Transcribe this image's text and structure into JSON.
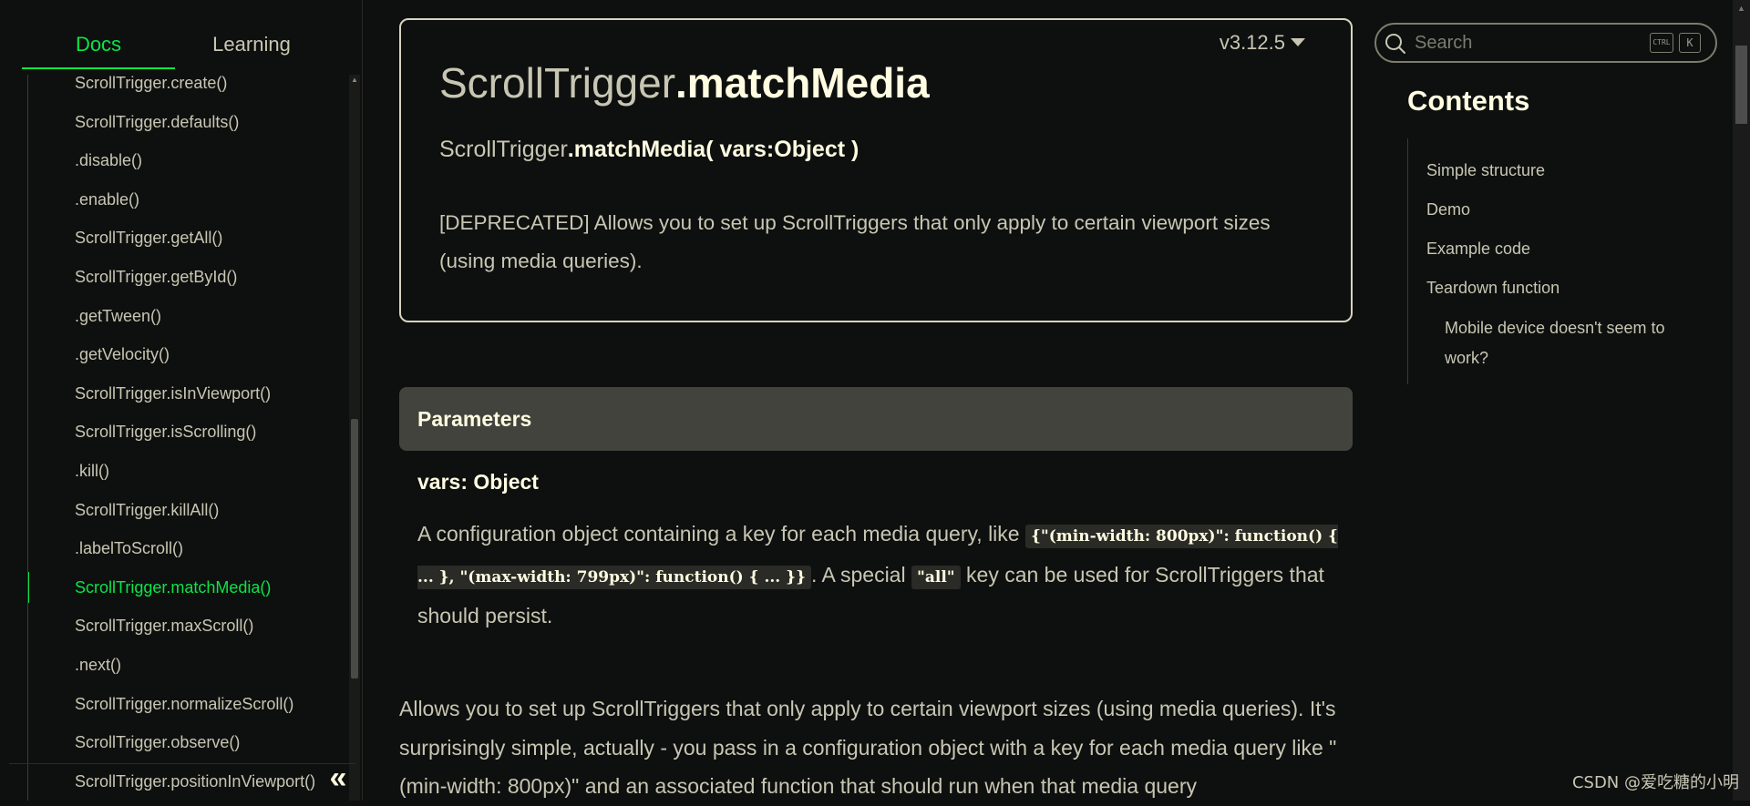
{
  "sidebar": {
    "tabs": [
      {
        "label": "Docs",
        "active": true
      },
      {
        "label": "Learning",
        "active": false
      }
    ],
    "nav_items": [
      "ScrollTrigger.create()",
      "ScrollTrigger.defaults()",
      ".disable()",
      ".enable()",
      "ScrollTrigger.getAll()",
      "ScrollTrigger.getById()",
      ".getTween()",
      ".getVelocity()",
      "ScrollTrigger.isInViewport()",
      "ScrollTrigger.isScrolling()",
      ".kill()",
      "ScrollTrigger.killAll()",
      ".labelToScroll()",
      "ScrollTrigger.matchMedia()",
      "ScrollTrigger.maxScroll()",
      ".next()",
      "ScrollTrigger.normalizeScroll()",
      "ScrollTrigger.observe()",
      "ScrollTrigger.positionInViewport()"
    ],
    "active_item": "ScrollTrigger.matchMedia()",
    "collapse_icon": "double-chevron-left-icon",
    "collapse_glyph": "«"
  },
  "header": {
    "version": "v3.12.5",
    "title_prefix": "ScrollTrigger",
    "title_method": ".matchMedia",
    "signature_prefix": "ScrollTrigger",
    "signature_method": ".matchMedia( vars:Object )",
    "description": "[DEPRECATED] Allows you to set up ScrollTriggers that only apply to certain viewport sizes (using media queries)."
  },
  "parameters": {
    "heading": "Parameters",
    "name": "vars: Object",
    "desc_part1": "A configuration object containing a key for each media query, like ",
    "code1": "{\"(min-width: 800px)\": function() { ... }, \"(max-width: 799px)\": function() { ... }}",
    "desc_part2": ". A special ",
    "code2": "\"all\"",
    "desc_part3": " key can be used for ScrollTriggers that should persist."
  },
  "body": {
    "paragraph": "Allows you to set up ScrollTriggers that only apply to certain viewport sizes (using media queries). It's surprisingly simple, actually - you pass in a configuration object with a key for each media query like \"(min-width: 800px)\" and an associated function that should run when that media query"
  },
  "search": {
    "placeholder": "Search",
    "shortcut_ctrl": "CTRL",
    "shortcut_key": "K"
  },
  "toc": {
    "title": "Contents",
    "items": [
      {
        "label": "Simple structure",
        "level": 1
      },
      {
        "label": "Demo",
        "level": 1
      },
      {
        "label": "Example code",
        "level": 1
      },
      {
        "label": "Teardown function",
        "level": 1
      },
      {
        "label": "Mobile device doesn't seem to work?",
        "level": 2
      }
    ]
  },
  "watermark": "CSDN @爱吃糖的小明",
  "colors": {
    "accent": "#0ae448",
    "background": "#0e100f",
    "text": "#fffce1",
    "muted_text": "#c8c6b3",
    "panel": "#42433d"
  }
}
